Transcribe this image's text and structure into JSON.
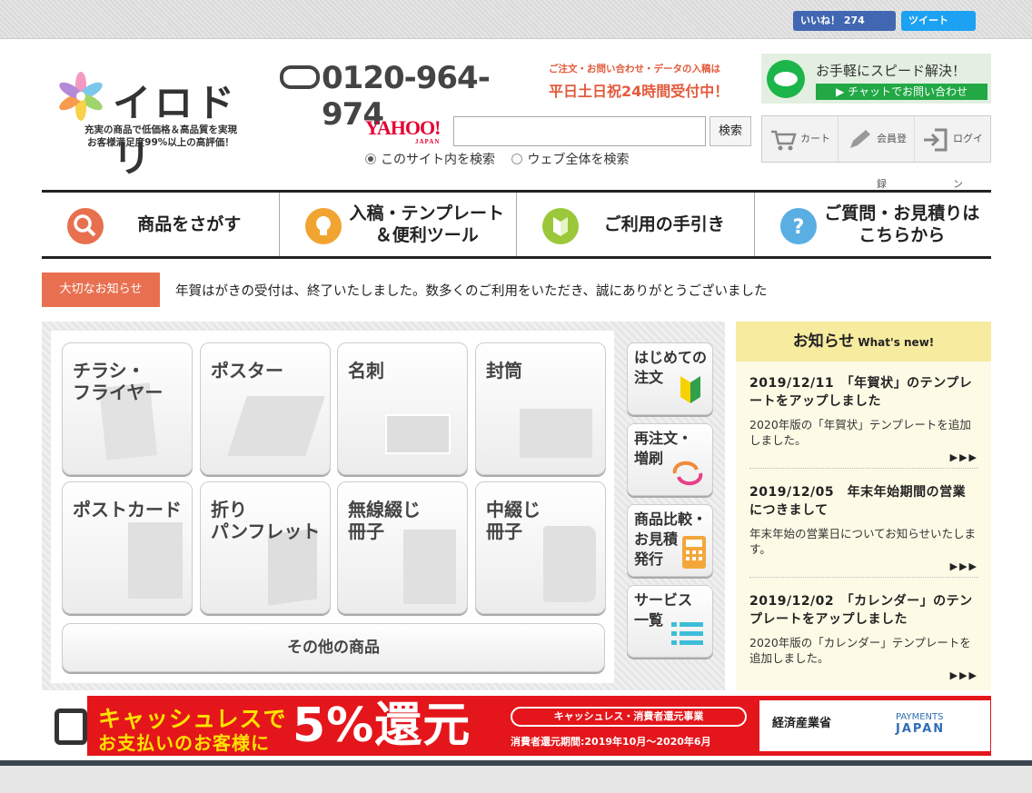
{
  "social": {
    "like_label": "いいね！ 274",
    "tweet_label": "ツイート"
  },
  "logo": {
    "name": "イロドリ",
    "tagline_1": "充実の商品で低価格＆高品質を実現",
    "tagline_2": "お客様満足度99%以上の高評価！"
  },
  "phone": {
    "number": "0120-964-974",
    "note_1": "ご注文・お問い合わせ・データの入稿は",
    "note_2": "平日土日祝24時間受付中！"
  },
  "chat": {
    "title": "お手軽にスピード解決！",
    "button": "▶ チャットでお問い合わせ"
  },
  "search": {
    "yahoo": "YAHOO!",
    "yahoo_sub": "JAPAN",
    "value": "",
    "button": "検索",
    "option_site": "このサイト内を検索",
    "option_web": "ウェブ全体を検索"
  },
  "account": {
    "cart": "カート",
    "register": "会員登録",
    "login": "ログイン"
  },
  "nav": [
    {
      "label": "商品をさがす",
      "color": "#e8704e"
    },
    {
      "label": "入稿・テンプレート\n＆便利ツール",
      "color": "#f2a431"
    },
    {
      "label": "ご利用の手引き",
      "color": "#9bc83b"
    },
    {
      "label": "ご質問・お見積りは\nこちらから",
      "color": "#5aaee3"
    }
  ],
  "notice": {
    "tag": "大切なお知らせ",
    "text": "年賀はがきの受付は、終了いたしました。数多くのご利用をいただき、誠にありがとうございました"
  },
  "products": [
    {
      "label": "チラシ・\nフライヤー"
    },
    {
      "label": "ポスター"
    },
    {
      "label": "名刺"
    },
    {
      "label": "封筒"
    },
    {
      "label": "ポストカード"
    },
    {
      "label": "折り\nパンフレット"
    },
    {
      "label": "無線綴じ\n冊子"
    },
    {
      "label": "中綴じ\n冊子"
    }
  ],
  "other_products": "その他の商品",
  "side_links": [
    {
      "label": "はじめての\n注文"
    },
    {
      "label": "再注文・\n増刷"
    },
    {
      "label": "商品比較・\nお見積\n発行"
    },
    {
      "label": "サービス\n一覧"
    }
  ],
  "news": {
    "title": "お知らせ",
    "subtitle": "What's new!",
    "items": [
      {
        "title": "2019/12/11　「年賀状」のテンプレートをアップしました",
        "body": "2020年版の「年賀状」テンプレートを追加しました。",
        "more": "▶▶▶"
      },
      {
        "title": "2019/12/05　年末年始期間の営業につきまして",
        "body": "年末年始の営業日についてお知らせいたします。",
        "more": "▶▶▶"
      },
      {
        "title": "2019/12/02　「カレンダー」のテンプレートをアップしました",
        "body": "2020年版の「カレンダー」テンプレートを追加しました。",
        "more": "▶▶▶"
      }
    ]
  },
  "banner": {
    "line1": "キャッシュレスで",
    "line2": "お支払いのお客様に",
    "big": "5%還元",
    "pill": "キャッシュレス・消費者還元事業",
    "period": "消費者還元期間:2019年10月〜2020年6月",
    "meti": "経済産業省",
    "pj_1": "PAYMENTS",
    "pj_2": "JAPAN"
  }
}
